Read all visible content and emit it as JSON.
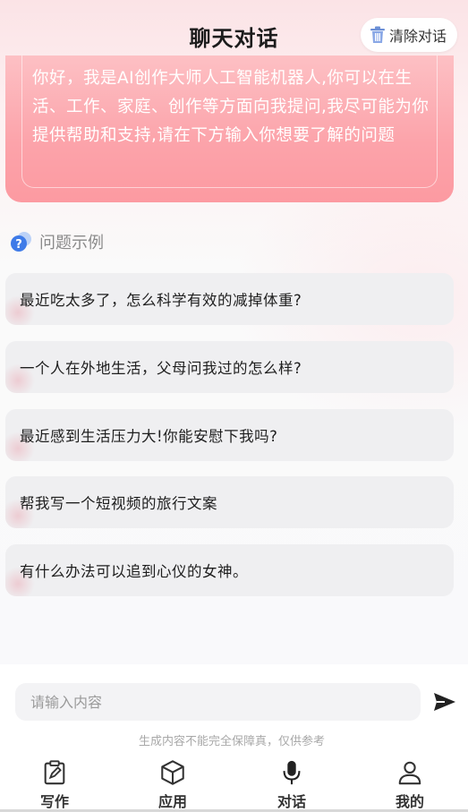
{
  "header": {
    "title": "聊天对话",
    "clear_label": "清除对话"
  },
  "welcome": {
    "text": "你好，我是AI创作大师人工智能机器人,你可以在生活、工作、家庭、创作等方面向我提问,我尽可能为你提供帮助和支持,请在下方输入你想要了解的问题"
  },
  "examples": {
    "title": "问题示例",
    "items": [
      "最近吃太多了，怎么科学有效的减掉体重?",
      "一个人在外地生活，父母问我过的怎么样?",
      "最近感到生活压力大!你能安慰下我吗?",
      "帮我写一个短视频的旅行文案",
      "有什么办法可以追到心仪的女神。"
    ]
  },
  "composer": {
    "placeholder": "请输入内容",
    "disclaimer": "生成内容不能完全保障真，仅供参考"
  },
  "tabs": [
    {
      "label": "写作",
      "icon": "clipboard-edit-icon"
    },
    {
      "label": "应用",
      "icon": "cube-icon"
    },
    {
      "label": "对话",
      "icon": "microphone-icon"
    },
    {
      "label": "我的",
      "icon": "user-icon"
    }
  ],
  "colors": {
    "welcome_gradient_top": "#fdc0c4",
    "welcome_gradient_bottom": "#fc9aa1",
    "question_bg": "#efeff1",
    "trash_icon": "#6b8fd6",
    "help_icon": "#3f7be8"
  }
}
